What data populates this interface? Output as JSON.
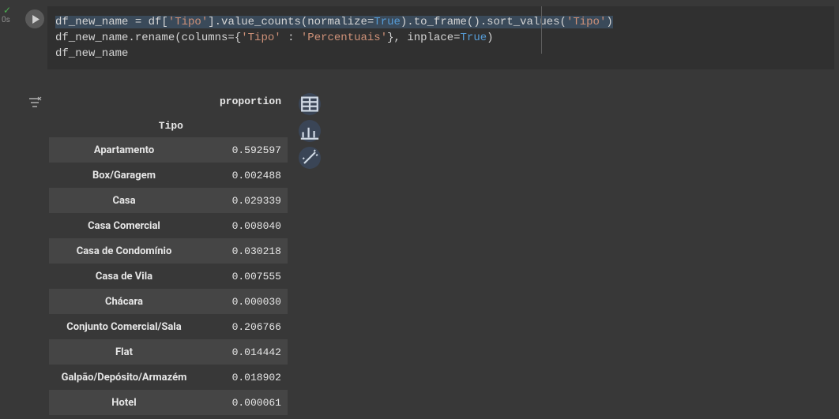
{
  "gutter": {
    "status_icon": "✓",
    "exec_time": "0s"
  },
  "code": {
    "line1_a": "df_new_name = df[",
    "line1_s1": "'Tipo'",
    "line1_b": "].value_counts(normalize=",
    "line1_k1": "True",
    "line1_c": ").to_frame().sort_values(",
    "line1_s2": "'Tipo'",
    "line1_d": ")",
    "line2_a": "df_new_name.rename(columns={",
    "line2_s1": "'Tipo'",
    "line2_b": " : ",
    "line2_s2": "'Percentuais'",
    "line2_c": "}, inplace=",
    "line2_k1": "True",
    "line2_d": ")",
    "line3": "df_new_name"
  },
  "dataframe": {
    "column_header": "proportion",
    "index_name": "Tipo",
    "rows": [
      {
        "idx": "Apartamento",
        "val": "0.592597"
      },
      {
        "idx": "Box/Garagem",
        "val": "0.002488"
      },
      {
        "idx": "Casa",
        "val": "0.029339"
      },
      {
        "idx": "Casa Comercial",
        "val": "0.008040"
      },
      {
        "idx": "Casa de Condomínio",
        "val": "0.030218"
      },
      {
        "idx": "Casa de Vila",
        "val": "0.007555"
      },
      {
        "idx": "Chácara",
        "val": "0.000030"
      },
      {
        "idx": "Conjunto Comercial/Sala",
        "val": "0.206766"
      },
      {
        "idx": "Flat",
        "val": "0.014442"
      },
      {
        "idx": "Galpão/Depósito/Armazém",
        "val": "0.018902"
      },
      {
        "idx": "Hotel",
        "val": "0.000061"
      }
    ]
  },
  "icons": {
    "table": "table-icon",
    "chart": "bar-chart-icon",
    "wand": "magic-wand-icon",
    "filter": "filter-variable-icon"
  }
}
